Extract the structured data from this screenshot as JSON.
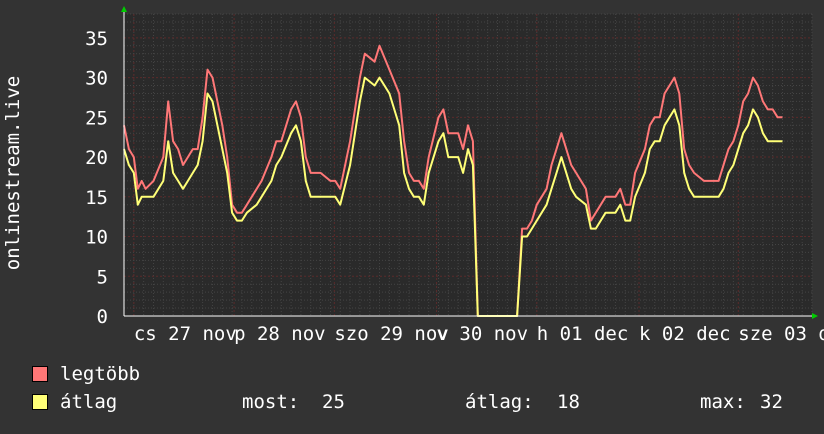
{
  "chart_data": {
    "type": "line",
    "ylabel": "onlinestream.live",
    "ylim": [
      0,
      38
    ],
    "yticks": [
      0,
      5,
      10,
      15,
      20,
      25,
      30,
      35
    ],
    "x_tick_labels": [
      "cs 27 nov",
      "p 28 nov",
      "szo 29 nov",
      "v 30 nov",
      "h 01 dec",
      "k 02 dec",
      "sze 03 dec"
    ],
    "x_range": [
      0,
      7
    ],
    "x_tick_positions": [
      0.1,
      1.12,
      2.14,
      3.18,
      4.2,
      5.24,
      6.25
    ],
    "grid": true,
    "colors": {
      "background": "#333333",
      "plot_background": "#2a2a2a",
      "grid_major": "#5a2a2a",
      "grid_minor": "#444444",
      "max_series": "#ff7777",
      "avg_series": "#ffff77",
      "axis": "#ffffff",
      "arrow": "#00cc00"
    },
    "series": [
      {
        "name": "legtöbb",
        "color": "#ff7777",
        "x": [
          0,
          0.05,
          0.1,
          0.14,
          0.18,
          0.22,
          0.3,
          0.4,
          0.45,
          0.5,
          0.55,
          0.6,
          0.65,
          0.7,
          0.75,
          0.8,
          0.85,
          0.9,
          1.0,
          1.05,
          1.1,
          1.15,
          1.2,
          1.25,
          1.35,
          1.4,
          1.5,
          1.55,
          1.6,
          1.7,
          1.75,
          1.8,
          1.85,
          1.9,
          2.0,
          2.1,
          2.15,
          2.2,
          2.3,
          2.35,
          2.4,
          2.45,
          2.55,
          2.6,
          2.7,
          2.8,
          2.85,
          2.9,
          2.95,
          3.0,
          3.05,
          3.1,
          3.2,
          3.25,
          3.3,
          3.4,
          3.45,
          3.5,
          3.55,
          3.6,
          3.65,
          3.7,
          3.72,
          3.75,
          3.8,
          3.9,
          3.95,
          3.98,
          4.0,
          4.05,
          4.1,
          4.15,
          4.2,
          4.3,
          4.35,
          4.4,
          4.45,
          4.5,
          4.55,
          4.6,
          4.7,
          4.75,
          4.8,
          4.9,
          5.0,
          5.05,
          5.1,
          5.15,
          5.2,
          5.3,
          5.35,
          5.4,
          5.45,
          5.5,
          5.6,
          5.65,
          5.7,
          5.75,
          5.8,
          5.9,
          6.0,
          6.05,
          6.1,
          6.15,
          6.2,
          6.25,
          6.3,
          6.35,
          6.4,
          6.45,
          6.5,
          6.55,
          6.6,
          6.65,
          6.7
        ],
        "y": [
          24,
          21,
          20,
          16,
          17,
          16,
          17,
          20,
          27,
          22,
          21,
          19,
          20,
          21,
          21,
          25,
          31,
          30,
          24,
          20,
          14,
          13,
          13,
          14,
          16,
          17,
          20,
          22,
          22,
          26,
          27,
          25,
          20,
          18,
          18,
          17,
          17,
          16,
          22,
          26,
          30,
          33,
          32,
          34,
          31,
          28,
          22,
          18,
          17,
          17,
          16,
          20,
          25,
          26,
          23,
          23,
          21,
          24,
          22,
          0,
          0,
          0,
          0,
          0,
          0,
          0,
          0,
          0,
          0,
          11,
          11,
          12,
          14,
          16,
          19,
          21,
          23,
          21,
          19,
          18,
          16,
          12,
          13,
          15,
          15,
          16,
          14,
          14,
          18,
          21,
          24,
          25,
          25,
          28,
          30,
          28,
          21,
          19,
          18,
          17,
          17,
          17,
          19,
          21,
          22,
          24,
          27,
          28,
          30,
          29,
          27,
          26,
          26,
          25,
          25
        ]
      },
      {
        "name": "átlag",
        "color": "#ffff77",
        "x": [
          0,
          0.05,
          0.1,
          0.14,
          0.18,
          0.22,
          0.3,
          0.4,
          0.45,
          0.5,
          0.55,
          0.6,
          0.65,
          0.7,
          0.75,
          0.8,
          0.85,
          0.9,
          1.0,
          1.05,
          1.1,
          1.15,
          1.2,
          1.25,
          1.35,
          1.4,
          1.5,
          1.55,
          1.6,
          1.7,
          1.75,
          1.8,
          1.85,
          1.9,
          2.0,
          2.1,
          2.15,
          2.2,
          2.3,
          2.35,
          2.4,
          2.45,
          2.55,
          2.6,
          2.7,
          2.8,
          2.85,
          2.9,
          2.95,
          3.0,
          3.05,
          3.1,
          3.2,
          3.25,
          3.3,
          3.4,
          3.45,
          3.5,
          3.55,
          3.6,
          3.65,
          3.7,
          3.72,
          3.75,
          3.8,
          3.9,
          3.95,
          3.98,
          4.0,
          4.05,
          4.1,
          4.15,
          4.2,
          4.3,
          4.35,
          4.4,
          4.45,
          4.5,
          4.55,
          4.6,
          4.7,
          4.75,
          4.8,
          4.9,
          5.0,
          5.05,
          5.1,
          5.15,
          5.2,
          5.3,
          5.35,
          5.4,
          5.45,
          5.5,
          5.6,
          5.65,
          5.7,
          5.75,
          5.8,
          5.9,
          6.0,
          6.05,
          6.1,
          6.15,
          6.2,
          6.25,
          6.3,
          6.35,
          6.4,
          6.45,
          6.5,
          6.55,
          6.6,
          6.65,
          6.7
        ],
        "y": [
          21,
          19,
          18,
          14,
          15,
          15,
          15,
          17,
          22,
          18,
          17,
          16,
          17,
          18,
          19,
          22,
          28,
          27,
          21,
          18,
          13,
          12,
          12,
          13,
          14,
          15,
          17,
          19,
          20,
          23,
          24,
          22,
          17,
          15,
          15,
          15,
          15,
          14,
          19,
          23,
          27,
          30,
          29,
          30,
          28,
          24,
          18,
          16,
          15,
          15,
          14,
          18,
          22,
          23,
          20,
          20,
          18,
          21,
          19,
          0,
          0,
          0,
          0,
          0,
          0,
          0,
          0,
          0,
          0,
          10,
          10,
          11,
          12,
          14,
          16,
          18,
          20,
          18,
          16,
          15,
          14,
          11,
          11,
          13,
          13,
          14,
          12,
          12,
          15,
          18,
          21,
          22,
          22,
          24,
          26,
          24,
          18,
          16,
          15,
          15,
          15,
          15,
          16,
          18,
          19,
          21,
          23,
          24,
          26,
          25,
          23,
          22,
          22,
          22,
          22
        ]
      }
    ]
  },
  "legend": {
    "max_label": "legtöbb",
    "avg_label": "átlag",
    "stats": {
      "now_label": "most:",
      "now_value": "25",
      "avg_label": "átlag:",
      "avg_value": "18",
      "max_label": "max:",
      "max_value": "32"
    }
  }
}
